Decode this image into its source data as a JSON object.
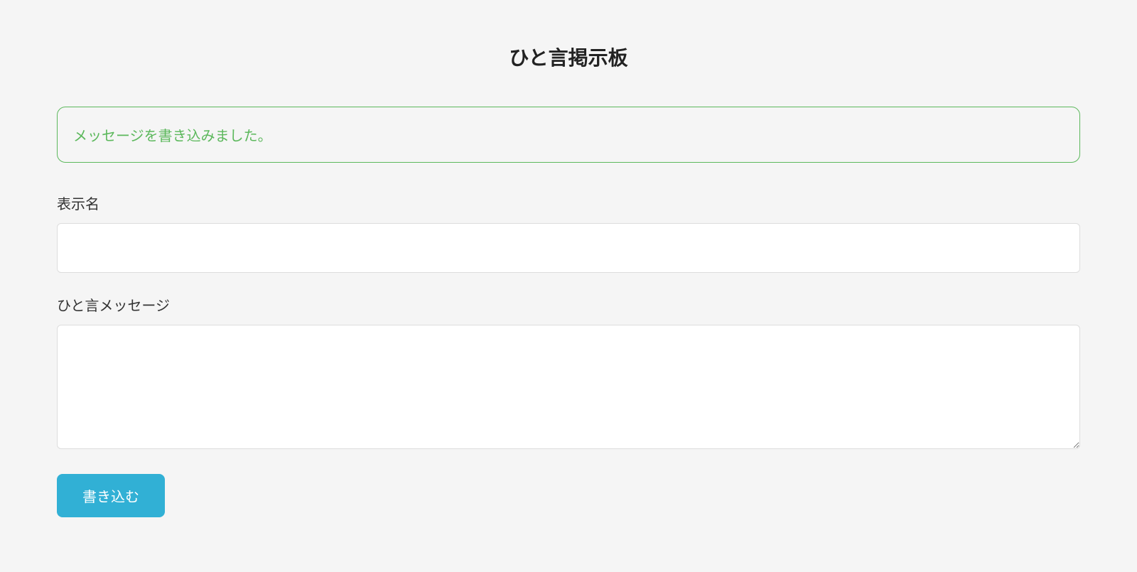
{
  "page": {
    "title": "ひと言掲示板"
  },
  "alert": {
    "message": "メッセージを書き込みました。"
  },
  "form": {
    "name_label": "表示名",
    "name_value": "",
    "message_label": "ひと言メッセージ",
    "message_value": "",
    "submit_label": "書き込む"
  }
}
